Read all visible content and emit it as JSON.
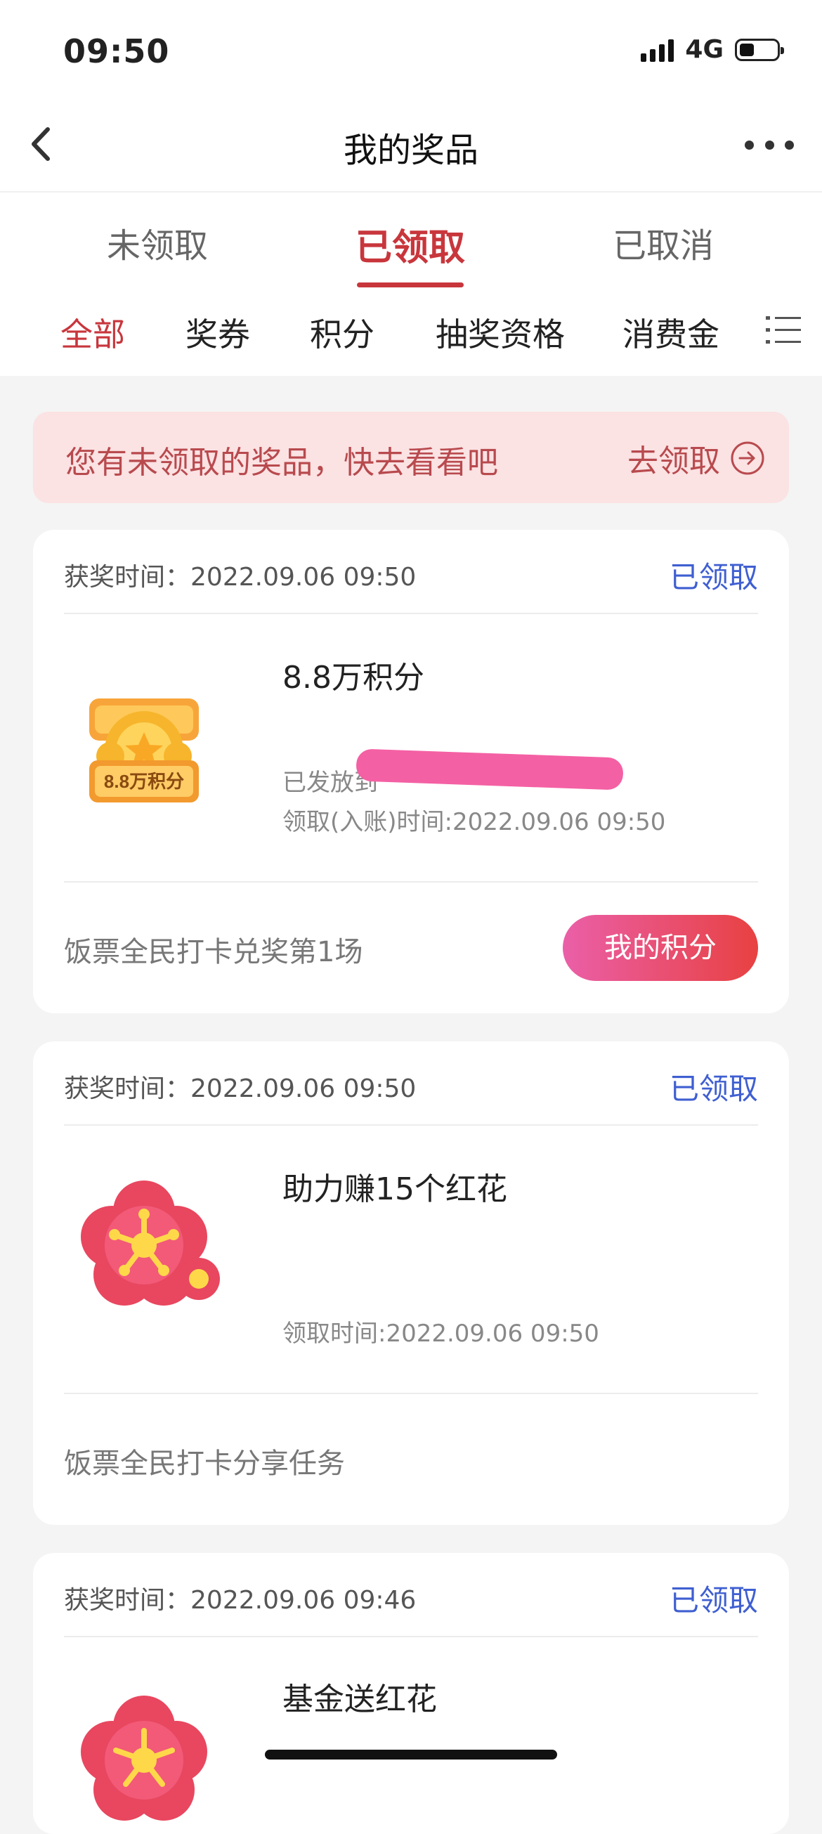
{
  "status": {
    "time": "09:50",
    "network": "4G"
  },
  "nav": {
    "title": "我的奖品"
  },
  "tabs": [
    "未领取",
    "已领取",
    "已取消"
  ],
  "active_tab": "已领取",
  "categories": [
    "全部",
    "奖券",
    "积分",
    "抽奖资格",
    "消费金"
  ],
  "active_category": "全部",
  "banner": {
    "text": "您有未领取的奖品，快去看看吧",
    "action": "去领取"
  },
  "cards": [
    {
      "time_label": "获奖时间：",
      "time": "2022.09.06 09:50",
      "status": "已领取",
      "title": "8.8万积分",
      "image_label": "8.8万积分",
      "line1": "已发放到",
      "line2": "领取(入账)时间:2022.09.06 09:50",
      "foot_text": "饭票全民打卡兑奖第1场",
      "foot_button": "我的积分"
    },
    {
      "time_label": "获奖时间：",
      "time": "2022.09.06 09:50",
      "status": "已领取",
      "title": "助力赚15个红花",
      "line2": "领取时间:2022.09.06 09:50",
      "foot_text": "饭票全民打卡分享任务"
    },
    {
      "time_label": "获奖时间：",
      "time": "2022.09.06 09:46",
      "status": "已领取",
      "title": "基金送红花"
    }
  ]
}
